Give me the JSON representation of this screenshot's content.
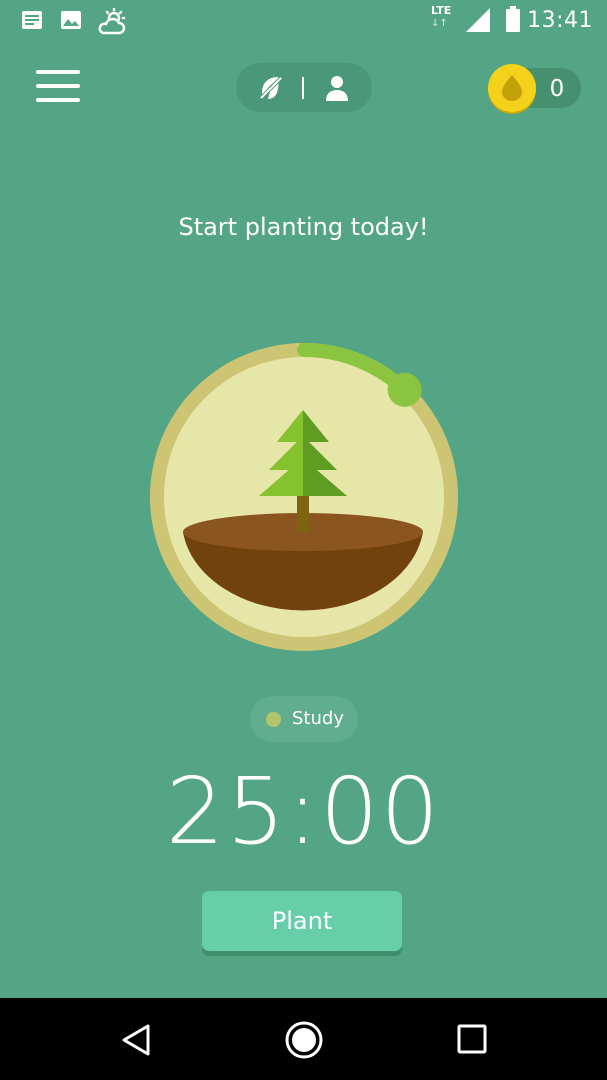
{
  "status_bar": {
    "time": "13:41",
    "network": "LTE",
    "icons": [
      "notification-news-icon",
      "image-icon",
      "weather-partly-cloudy-icon",
      "lte-icon",
      "signal-icon",
      "battery-icon"
    ]
  },
  "header": {
    "menu_icon": "hamburger-menu-icon",
    "mode_toggle": {
      "left_icon": "sleep-mode-icon",
      "right_icon": "person-icon"
    },
    "coins": {
      "icon": "coin-icon",
      "count": "0"
    }
  },
  "main": {
    "headline": "Start planting today!",
    "tree_icon": "pine-tree-icon",
    "progress": 0.12,
    "tag": {
      "label": "Study",
      "color": "#b3c46a"
    },
    "timer": "25:00",
    "plant_button_label": "Plant"
  },
  "nav_bar": {
    "icons": [
      "back-icon",
      "home-icon",
      "recents-icon"
    ]
  },
  "colors": {
    "background": "#53a586",
    "button": "#66cfa9",
    "progress_ring": "#8bc53f",
    "coin": "#f4d21c"
  }
}
